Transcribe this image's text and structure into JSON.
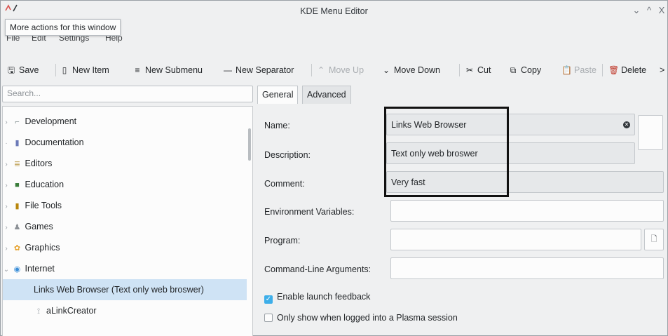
{
  "window": {
    "title": "KDE Menu Editor",
    "tooltip": "More actions for this window",
    "minimize_glyph": "⌄",
    "maximize_glyph": "^",
    "close_glyph": "X"
  },
  "menubar": [
    "File",
    "Edit",
    "Settings",
    "Help"
  ],
  "toolbar": {
    "save": "Save",
    "new_item": "New Item",
    "new_submenu": "New Submenu",
    "new_separator": "New Separator",
    "move_up": "Move Up",
    "move_down": "Move Down",
    "cut": "Cut",
    "copy": "Copy",
    "paste": "Paste",
    "delete": "Delete",
    "overflow": ">"
  },
  "search": {
    "placeholder": "Search..."
  },
  "tree": {
    "items": [
      {
        "label": "Development",
        "icon": "development-icon",
        "color": "#7f8c8d"
      },
      {
        "label": "Documentation",
        "icon": "documentation-icon",
        "color": "#6c7ab8"
      },
      {
        "label": "Editors",
        "icon": "editors-icon",
        "color": "#c0a35a"
      },
      {
        "label": "Education",
        "icon": "education-icon",
        "color": "#3b7d3b"
      },
      {
        "label": "File Tools",
        "icon": "file-tools-icon",
        "color": "#b8860b"
      },
      {
        "label": "Games",
        "icon": "games-icon",
        "color": "#8c9196"
      },
      {
        "label": "Graphics",
        "icon": "graphics-icon",
        "color": "#e6a12b"
      },
      {
        "label": "Internet",
        "icon": "internet-icon",
        "color": "#3a8ed8"
      },
      {
        "label": "Links Web Browser (Text only web broswer)",
        "icon": "",
        "color": ""
      },
      {
        "label": "aLinkCreator",
        "icon": "alinkcreator-icon",
        "color": "#9aa0a6"
      }
    ]
  },
  "tabs": {
    "general": "General",
    "advanced": "Advanced"
  },
  "form": {
    "name_label": "Name:",
    "name_value": "Links Web Browser",
    "description_label": "Description:",
    "description_value": "Text only web broswer",
    "comment_label": "Comment:",
    "comment_value": "Very fast",
    "env_label": "Environment Variables:",
    "env_value": "",
    "program_label": "Program:",
    "program_value": "",
    "args_label": "Command-Line Arguments:",
    "args_value": "",
    "launch_feedback": "Enable launch feedback",
    "launch_feedback_checked": true,
    "plasma_only": "Only show when logged into a Plasma session",
    "plasma_only_checked": false
  },
  "colors": {
    "accent": "#3daee9",
    "selection": "#cfe3f5"
  }
}
